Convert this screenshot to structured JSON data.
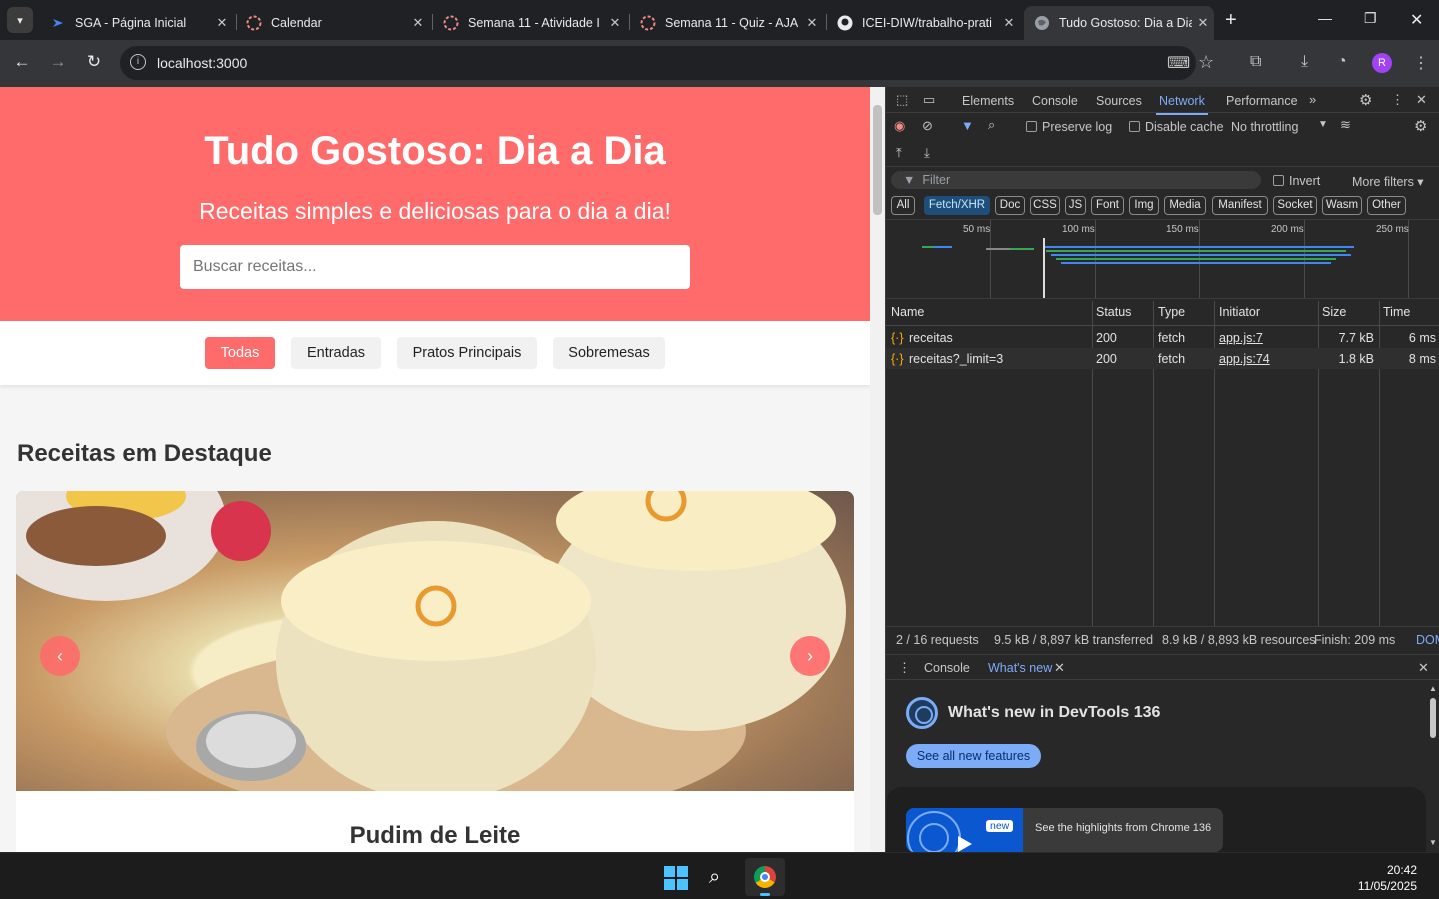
{
  "browser": {
    "tabs": [
      {
        "title": "SGA - Página Inicial",
        "active": false
      },
      {
        "title": "Calendar",
        "active": false
      },
      {
        "title": "Semana 11 - Atividade I",
        "active": false
      },
      {
        "title": "Semana 11 - Quiz - AJA",
        "active": false
      },
      {
        "title": "ICEI-DIW/trabalho-prati",
        "active": false
      },
      {
        "title": "Tudo Gostoso: Dia a Dia",
        "active": true
      }
    ],
    "url": "localhost:3000",
    "avatar_letter": "R"
  },
  "page": {
    "title": "Tudo Gostoso: Dia a Dia",
    "subtitle": "Receitas simples e deliciosas para o dia a dia!",
    "search_placeholder": "Buscar receitas...",
    "categories": [
      "Todas",
      "Entradas",
      "Pratos Principais",
      "Sobremesas"
    ],
    "active_category": "Todas",
    "section_title": "Receitas em Destaque",
    "featured": {
      "title": "Pudim de Leite",
      "prev": "‹",
      "next": "›"
    },
    "accent_color": "#ff6b6b"
  },
  "devtools": {
    "tabs": [
      "Elements",
      "Console",
      "Sources",
      "Network",
      "Performance"
    ],
    "active_tab": "Network",
    "preserve_log": "Preserve log",
    "disable_cache": "Disable cache",
    "throttling": "No throttling",
    "filter_placeholder": "Filter",
    "invert": "Invert",
    "more_filters": "More filters",
    "type_filters": [
      "All",
      "Fetch/XHR",
      "Doc",
      "CSS",
      "JS",
      "Font",
      "Img",
      "Media",
      "Manifest",
      "Socket",
      "Wasm",
      "Other"
    ],
    "active_type_filter": "Fetch/XHR",
    "timeline_ticks": [
      "50 ms",
      "100 ms",
      "150 ms",
      "200 ms",
      "250 ms"
    ],
    "columns": [
      "Name",
      "Status",
      "Type",
      "Initiator",
      "Size",
      "Time"
    ],
    "requests": [
      {
        "name": "receitas",
        "status": "200",
        "type": "fetch",
        "initiator": "app.js:7",
        "size": "7.7 kB",
        "time": "6 ms"
      },
      {
        "name": "receitas?_limit=3",
        "status": "200",
        "type": "fetch",
        "initiator": "app.js:74",
        "size": "1.8 kB",
        "time": "8 ms"
      }
    ],
    "summary": {
      "requests": "2 / 16 requests",
      "transferred": "9.5 kB / 8,897 kB transferred",
      "resources": "8.9 kB / 8,893 kB resources",
      "finish": "Finish: 209 ms",
      "dom": "DOM"
    },
    "drawer": {
      "tabs": [
        "Console",
        "What's new"
      ],
      "active": "What's new",
      "heading": "What's new in DevTools 136",
      "button": "See all new features",
      "badge": "new",
      "highlight": "See the highlights from Chrome 136"
    }
  },
  "taskbar": {
    "time": "20:42",
    "date": "11/05/2025"
  }
}
